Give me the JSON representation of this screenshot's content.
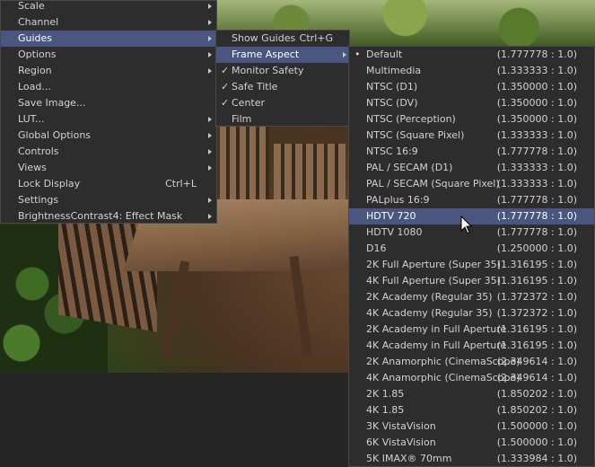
{
  "main_menu": {
    "items": [
      {
        "label": "Scale",
        "shortcut": "",
        "submenu": true,
        "highlighted": false
      },
      {
        "label": "Channel",
        "shortcut": "",
        "submenu": true,
        "highlighted": false
      },
      {
        "label": "Guides",
        "shortcut": "",
        "submenu": true,
        "highlighted": true
      },
      {
        "label": "Options",
        "shortcut": "",
        "submenu": true,
        "highlighted": false
      },
      {
        "label": "Region",
        "shortcut": "",
        "submenu": true,
        "highlighted": false
      },
      {
        "label": "Load...",
        "shortcut": "",
        "submenu": false,
        "highlighted": false
      },
      {
        "label": "Save Image...",
        "shortcut": "",
        "submenu": false,
        "highlighted": false
      },
      {
        "label": "LUT...",
        "shortcut": "",
        "submenu": true,
        "highlighted": false
      },
      {
        "label": "Global Options",
        "shortcut": "",
        "submenu": true,
        "highlighted": false
      },
      {
        "label": "Controls",
        "shortcut": "",
        "submenu": true,
        "highlighted": false
      },
      {
        "label": "Views",
        "shortcut": "",
        "submenu": true,
        "highlighted": false
      },
      {
        "label": "Lock Display",
        "shortcut": "Ctrl+L",
        "submenu": false,
        "highlighted": false
      },
      {
        "label": "Settings",
        "shortcut": "",
        "submenu": true,
        "highlighted": false
      },
      {
        "label": "BrightnessContrast4: Effect Mask",
        "shortcut": "",
        "submenu": true,
        "highlighted": false
      }
    ]
  },
  "guides_menu": {
    "items": [
      {
        "label": "Show Guides",
        "shortcut": "Ctrl+G",
        "submenu": false,
        "checked": false,
        "highlighted": false
      },
      {
        "label": "Frame Aspect",
        "shortcut": "",
        "submenu": true,
        "checked": false,
        "highlighted": true
      },
      {
        "label": "Monitor Safety",
        "shortcut": "",
        "submenu": false,
        "checked": true,
        "highlighted": false
      },
      {
        "label": "Safe Title",
        "shortcut": "",
        "submenu": false,
        "checked": true,
        "highlighted": false
      },
      {
        "label": "Center",
        "shortcut": "",
        "submenu": false,
        "checked": true,
        "highlighted": false
      },
      {
        "label": "Film",
        "shortcut": "",
        "submenu": false,
        "checked": false,
        "highlighted": false
      }
    ]
  },
  "frame_aspect_menu": {
    "items": [
      {
        "label": "Default",
        "ratio": "(1.777778 : 1.0)",
        "selected": true,
        "highlighted": false
      },
      {
        "label": "Multimedia",
        "ratio": "(1.333333 : 1.0)",
        "selected": false,
        "highlighted": false
      },
      {
        "label": "NTSC (D1)",
        "ratio": "(1.350000 : 1.0)",
        "selected": false,
        "highlighted": false
      },
      {
        "label": "NTSC (DV)",
        "ratio": "(1.350000 : 1.0)",
        "selected": false,
        "highlighted": false
      },
      {
        "label": "NTSC (Perception)",
        "ratio": "(1.350000 : 1.0)",
        "selected": false,
        "highlighted": false
      },
      {
        "label": "NTSC (Square Pixel)",
        "ratio": "(1.333333 : 1.0)",
        "selected": false,
        "highlighted": false
      },
      {
        "label": "NTSC 16:9",
        "ratio": "(1.777778 : 1.0)",
        "selected": false,
        "highlighted": false
      },
      {
        "label": "PAL / SECAM (D1)",
        "ratio": "(1.333333 : 1.0)",
        "selected": false,
        "highlighted": false
      },
      {
        "label": "PAL / SECAM (Square Pixel)",
        "ratio": "(1.333333 : 1.0)",
        "selected": false,
        "highlighted": false
      },
      {
        "label": "PALplus 16:9",
        "ratio": "(1.777778 : 1.0)",
        "selected": false,
        "highlighted": false
      },
      {
        "label": "HDTV 720",
        "ratio": "(1.777778 : 1.0)",
        "selected": false,
        "highlighted": true
      },
      {
        "label": "HDTV 1080",
        "ratio": "(1.777778 : 1.0)",
        "selected": false,
        "highlighted": false
      },
      {
        "label": "D16",
        "ratio": "(1.250000 : 1.0)",
        "selected": false,
        "highlighted": false
      },
      {
        "label": "2K Full Aperture (Super 35)",
        "ratio": "(1.316195 : 1.0)",
        "selected": false,
        "highlighted": false
      },
      {
        "label": "4K Full Aperture (Super 35)",
        "ratio": "(1.316195 : 1.0)",
        "selected": false,
        "highlighted": false
      },
      {
        "label": "2K Academy (Regular 35)",
        "ratio": "(1.372372 : 1.0)",
        "selected": false,
        "highlighted": false
      },
      {
        "label": "4K Academy (Regular 35)",
        "ratio": "(1.372372 : 1.0)",
        "selected": false,
        "highlighted": false
      },
      {
        "label": "2K Academy in Full Aperture",
        "ratio": "(1.316195 : 1.0)",
        "selected": false,
        "highlighted": false
      },
      {
        "label": "4K Academy in Full Aperture",
        "ratio": "(1.316195 : 1.0)",
        "selected": false,
        "highlighted": false
      },
      {
        "label": "2K Anamorphic (CinemaScope)",
        "ratio": "(2.349614 : 1.0)",
        "selected": false,
        "highlighted": false
      },
      {
        "label": "4K Anamorphic (CinemaScope)",
        "ratio": "(2.349614 : 1.0)",
        "selected": false,
        "highlighted": false
      },
      {
        "label": "2K 1.85",
        "ratio": "(1.850202 : 1.0)",
        "selected": false,
        "highlighted": false
      },
      {
        "label": "4K 1.85",
        "ratio": "(1.850202 : 1.0)",
        "selected": false,
        "highlighted": false
      },
      {
        "label": "3K VistaVision",
        "ratio": "(1.500000 : 1.0)",
        "selected": false,
        "highlighted": false
      },
      {
        "label": "6K VistaVision",
        "ratio": "(1.500000 : 1.0)",
        "selected": false,
        "highlighted": false
      },
      {
        "label": "5K IMAX® 70mm",
        "ratio": "(1.333984 : 1.0)",
        "selected": false,
        "highlighted": false
      }
    ]
  },
  "colors": {
    "highlight": "#4a5580",
    "menu_bg": "#2d2d2d",
    "text": "#d2d2d2"
  }
}
